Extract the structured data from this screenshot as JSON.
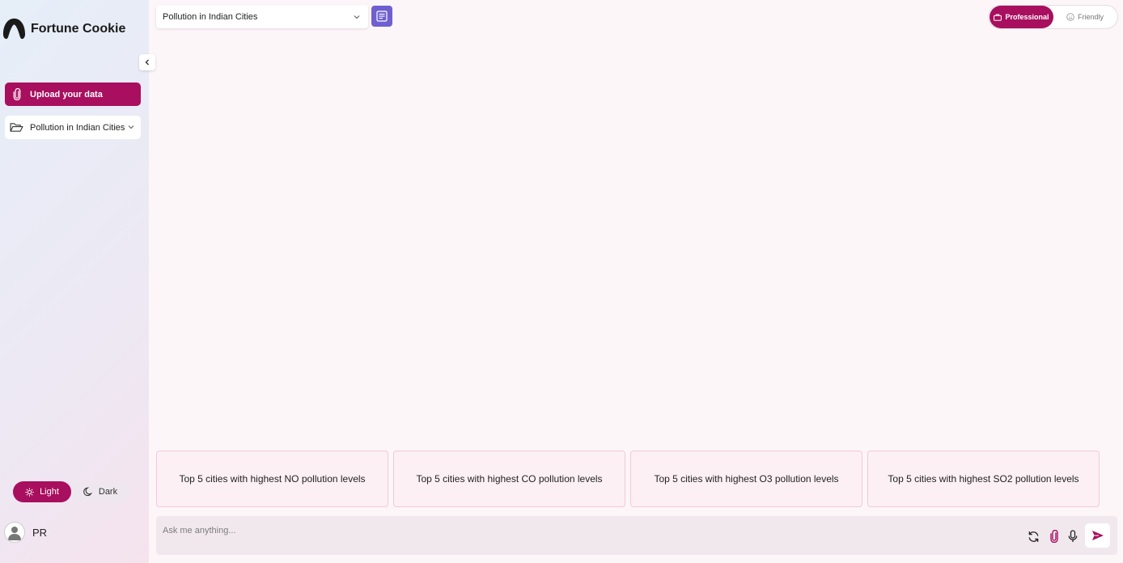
{
  "app": {
    "name": "Fortune Cookie"
  },
  "sidebar": {
    "upload_label": "Upload your data",
    "dataset_item": "Pollution in Indian Cities",
    "theme": {
      "light_label": "Light",
      "dark_label": "Dark",
      "selected": "Light"
    },
    "user": {
      "name": "PR"
    }
  },
  "header": {
    "dataset_select_value": "Pollution in Indian Cities",
    "tone": {
      "professional_label": "Professional",
      "friendly_label": "Friendly",
      "selected": "Professional"
    }
  },
  "suggestions": [
    "Top 5 cities with highest NO pollution levels",
    "Top 5 cities with highest CO pollution levels",
    "Top 5 cities with highest O3 pollution levels",
    "Top 5 cities with highest SO2 pollution levels"
  ],
  "chat": {
    "placeholder": "Ask me anything..."
  },
  "colors": {
    "accent": "#a80f5e",
    "notes_button": "#6f5fd0"
  }
}
